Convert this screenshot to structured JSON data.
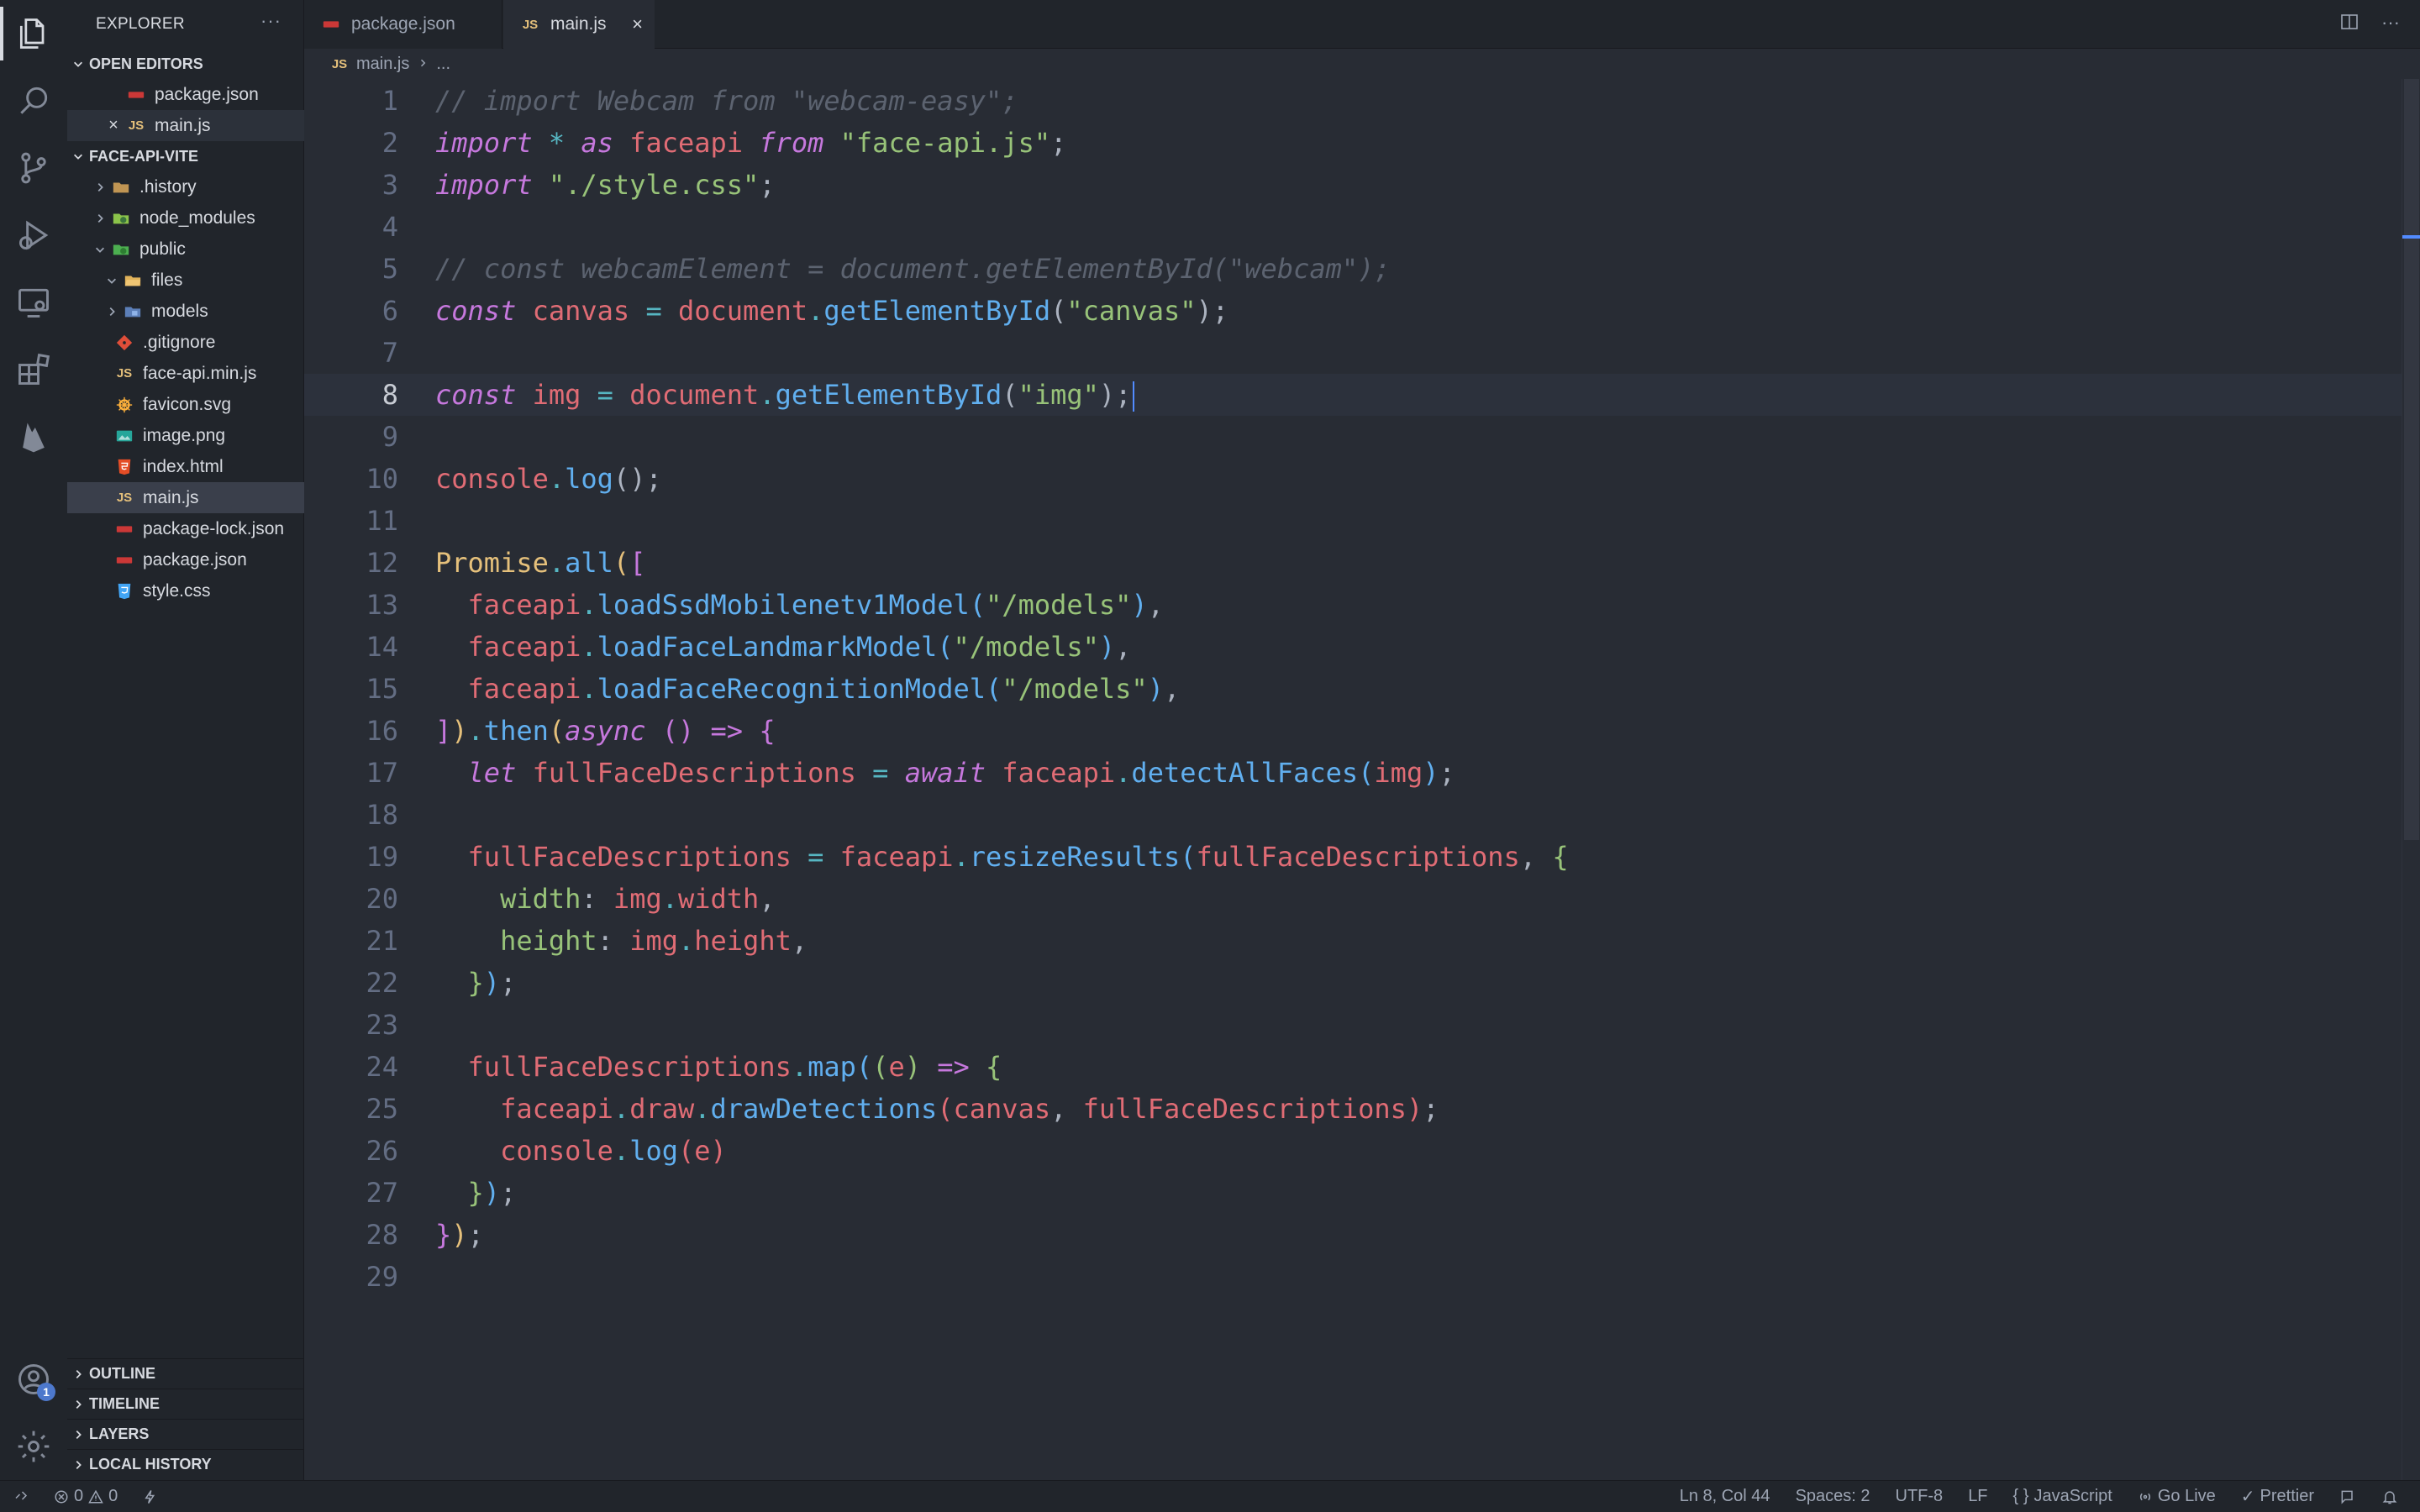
{
  "sidebar": {
    "title": "EXPLORER",
    "more": "···",
    "open_editors": {
      "label": "OPEN EDITORS",
      "items": [
        {
          "name": "package.json"
        },
        {
          "name": "main.js"
        }
      ]
    },
    "project": {
      "label": "FACE-API-VITE",
      "items": [
        {
          "name": ".history"
        },
        {
          "name": "node_modules"
        },
        {
          "name": "public"
        },
        {
          "name": "files"
        },
        {
          "name": "models"
        },
        {
          "name": ".gitignore"
        },
        {
          "name": "face-api.min.js"
        },
        {
          "name": "favicon.svg"
        },
        {
          "name": "image.png"
        },
        {
          "name": "index.html"
        },
        {
          "name": "main.js"
        },
        {
          "name": "package-lock.json"
        },
        {
          "name": "package.json"
        },
        {
          "name": "style.css"
        }
      ]
    },
    "bottom_sections": {
      "outline": "OUTLINE",
      "timeline": "TIMELINE",
      "layers": "LAYERS",
      "local_history": "LOCAL HISTORY"
    }
  },
  "js_badge": "JS",
  "tabs": [
    {
      "label": "package.json"
    },
    {
      "label": "main.js"
    }
  ],
  "breadcrumb": {
    "file": "main.js",
    "rest": "..."
  },
  "activity_badge": "1",
  "editor": {
    "lines": [
      "1",
      "2",
      "3",
      "4",
      "5",
      "6",
      "7",
      "8",
      "9",
      "10",
      "11",
      "12",
      "13",
      "14",
      "15",
      "16",
      "17",
      "18",
      "19",
      "20",
      "21",
      "22",
      "23",
      "24",
      "25",
      "26",
      "27",
      "28",
      "29"
    ],
    "code": {
      "l1": "// import Webcam from \"webcam-easy\";",
      "l2_import": "import",
      "l2_star": "*",
      "l2_as": "as",
      "l2_name": "faceapi",
      "l2_from": "from",
      "l2_str": "\"face-api.js\"",
      "l3_import": "import",
      "l3_str": "\"./style.css\"",
      "l5": "// const webcamElement = document.getElementById(\"webcam\");",
      "l6_const": "const",
      "l6_var": "canvas",
      "l6_doc": "document",
      "l6_fn": "getElementById",
      "l6_str": "\"canvas\"",
      "l8_const": "const",
      "l8_var": "img",
      "l8_doc": "document",
      "l8_fn": "getElementById",
      "l8_str": "\"img\"",
      "l10_obj": "console",
      "l10_fn": "log",
      "l12_obj": "Promise",
      "l12_fn": "all",
      "l13_obj": "faceapi",
      "l13_fn": "loadSsdMobilenetv1Model",
      "l13_str": "\"/models\"",
      "l14_obj": "faceapi",
      "l14_fn": "loadFaceLandmarkModel",
      "l14_str": "\"/models\"",
      "l15_obj": "faceapi",
      "l15_fn": "loadFaceRecognitionModel",
      "l15_str": "\"/models\"",
      "l16_then": "then",
      "l16_async": "async",
      "l17_let": "let",
      "l17_var": "fullFaceDescriptions",
      "l17_await": "await",
      "l17_obj": "faceapi",
      "l17_fn": "detectAllFaces",
      "l17_arg": "img",
      "l19_var": "fullFaceDescriptions",
      "l19_obj": "faceapi",
      "l19_fn": "resizeResults",
      "l19_arg": "fullFaceDescriptions",
      "l20_key": "width",
      "l20_obj": "img",
      "l20_prop": "width",
      "l21_key": "height",
      "l21_obj": "img",
      "l21_prop": "height",
      "l24_var": "fullFaceDescriptions",
      "l24_fn": "map",
      "l24_param": "e",
      "l25_obj": "faceapi",
      "l25_prop": "draw",
      "l25_fn": "drawDetections",
      "l25_a1": "canvas",
      "l25_a2": "fullFaceDescriptions",
      "l26_obj": "console",
      "l26_fn": "log",
      "l26_arg": "e"
    }
  },
  "status": {
    "errors": "0",
    "warnings": "0",
    "position": "Ln 8, Col 44",
    "spaces": "Spaces: 2",
    "encoding": "UTF-8",
    "eol": "LF",
    "language": "JavaScript",
    "golive": "Go Live",
    "prettier": "Prettier"
  },
  "colors": {
    "background": "#282c34",
    "sidebar": "#21252b",
    "accent": "#528bff",
    "keyword": "#c678dd",
    "string": "#98c379",
    "function": "#61afef",
    "variable": "#e06c75"
  }
}
